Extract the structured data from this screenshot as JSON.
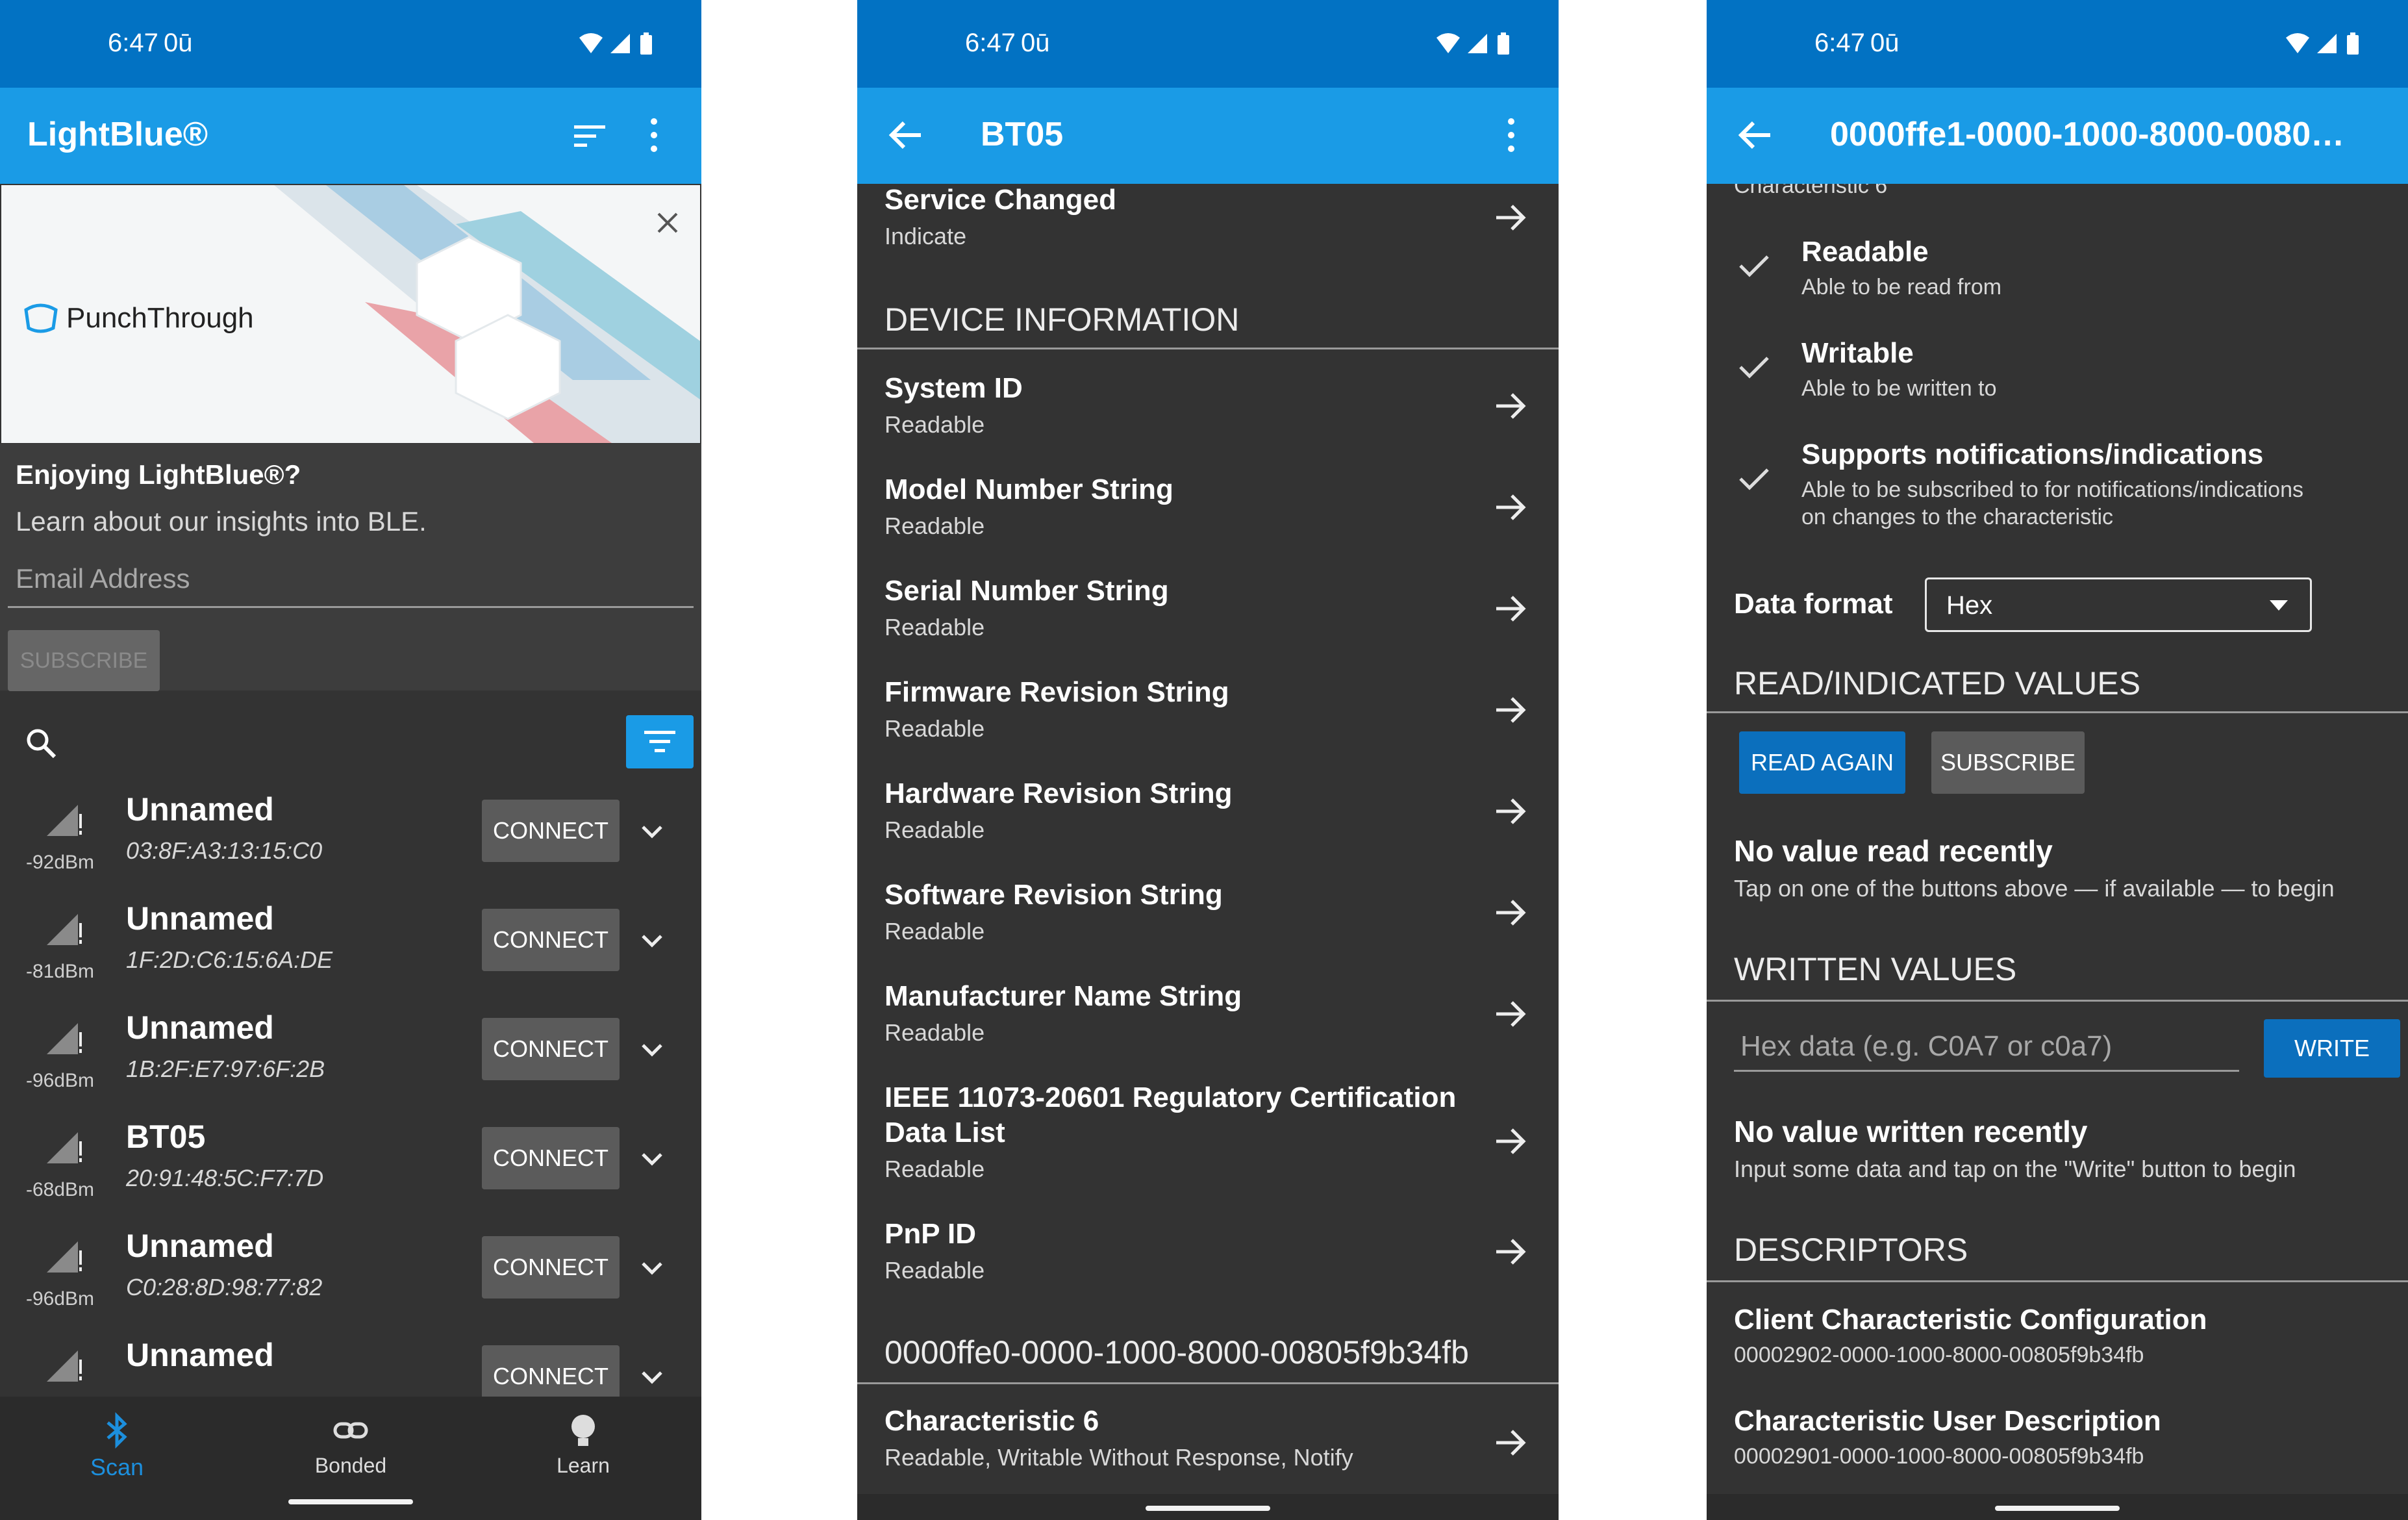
{
  "status_bar": {
    "time": "6:47",
    "vpn_badge": "0ū"
  },
  "scan_screen": {
    "title": "LightBlue®",
    "banner": {
      "brand": "PunchThrough",
      "headline": "Enjoying LightBlue®?",
      "subtitle": "Learn about our insights into BLE.",
      "email_placeholder": "Email Address",
      "subscribe_label": "SUBSCRIBE"
    },
    "devices": [
      {
        "name": "Unnamed",
        "address": "03:8F:A3:13:15:C0",
        "rssi": "-92dBm",
        "connect_label": "CONNECT"
      },
      {
        "name": "Unnamed",
        "address": "1F:2D:C6:15:6A:DE",
        "rssi": "-81dBm",
        "connect_label": "CONNECT"
      },
      {
        "name": "Unnamed",
        "address": "1B:2F:E7:97:6F:2B",
        "rssi": "-96dBm",
        "connect_label": "CONNECT"
      },
      {
        "name": "BT05",
        "address": "20:91:48:5C:F7:7D",
        "rssi": "-68dBm",
        "connect_label": "CONNECT"
      },
      {
        "name": "Unnamed",
        "address": "C0:28:8D:98:77:82",
        "rssi": "-96dBm",
        "connect_label": "CONNECT"
      },
      {
        "name": "Unnamed",
        "address": "",
        "rssi": "",
        "connect_label": "CONNECT"
      }
    ],
    "bottom_nav": [
      {
        "label": "Scan",
        "icon": "bluetooth-icon",
        "active": true
      },
      {
        "label": "Bonded",
        "icon": "link-icon",
        "active": false
      },
      {
        "label": "Learn",
        "icon": "lightbulb-icon",
        "active": false
      }
    ]
  },
  "device_screen": {
    "title": "BT05",
    "top_item": {
      "name": "Service Changed",
      "props": "Indicate"
    },
    "section_device_info": "DEVICE INFORMATION",
    "items": [
      {
        "name": "System ID",
        "props": "Readable"
      },
      {
        "name": "Model Number String",
        "props": "Readable"
      },
      {
        "name": "Serial Number String",
        "props": "Readable"
      },
      {
        "name": "Firmware Revision String",
        "props": "Readable"
      },
      {
        "name": "Hardware Revision String",
        "props": "Readable"
      },
      {
        "name": "Software Revision String",
        "props": "Readable"
      },
      {
        "name": "Manufacturer Name String",
        "props": "Readable"
      },
      {
        "name_line1": "IEEE 11073-20601 Regulatory Certification",
        "name_line2": "Data List",
        "props": "Readable"
      },
      {
        "name": "PnP ID",
        "props": "Readable"
      }
    ],
    "section_custom_service": "0000ffe0-0000-1000-8000-00805f9b34fb",
    "custom_item": {
      "name": "Characteristic 6",
      "props": "Readable, Writable Without Response, Notify"
    }
  },
  "characteristic_screen": {
    "title": "0000ffe1-0000-1000-8000-0080…",
    "cut_label": "Characteristic 6",
    "properties": [
      {
        "title": "Readable",
        "desc": "Able to be read from"
      },
      {
        "title": "Writable",
        "desc": "Able to be written to"
      },
      {
        "title": "Supports notifications/indications",
        "desc_line1": "Able to be subscribed to for notifications/indications",
        "desc_line2": "on changes to the characteristic"
      }
    ],
    "data_format_label": "Data format",
    "data_format_value": "Hex",
    "section_read": "READ/INDICATED VALUES",
    "read_again_label": "READ AGAIN",
    "subscribe_label": "SUBSCRIBE",
    "no_read_title": "No value read recently",
    "no_read_desc": "Tap on one of the buttons above — if available — to begin",
    "section_written": "WRITTEN VALUES",
    "hex_placeholder": "Hex data (e.g. C0A7 or c0a7)",
    "write_label": "WRITE",
    "no_write_title": "No value written recently",
    "no_write_desc": "Input some data and tap on the \"Write\" button to begin",
    "section_descriptors": "DESCRIPTORS",
    "descriptors": [
      {
        "name": "Client Characteristic Configuration",
        "uuid": "00002902-0000-1000-8000-00805f9b34fb"
      },
      {
        "name": "Characteristic User Description",
        "uuid": "00002901-0000-1000-8000-00805f9b34fb"
      }
    ]
  },
  "colors": {
    "status_bar": "#0272c3",
    "app_bar": "#1a9be6",
    "background": "#333333",
    "accent": "#1c8fdd",
    "button_grey": "#5b5b5b"
  }
}
